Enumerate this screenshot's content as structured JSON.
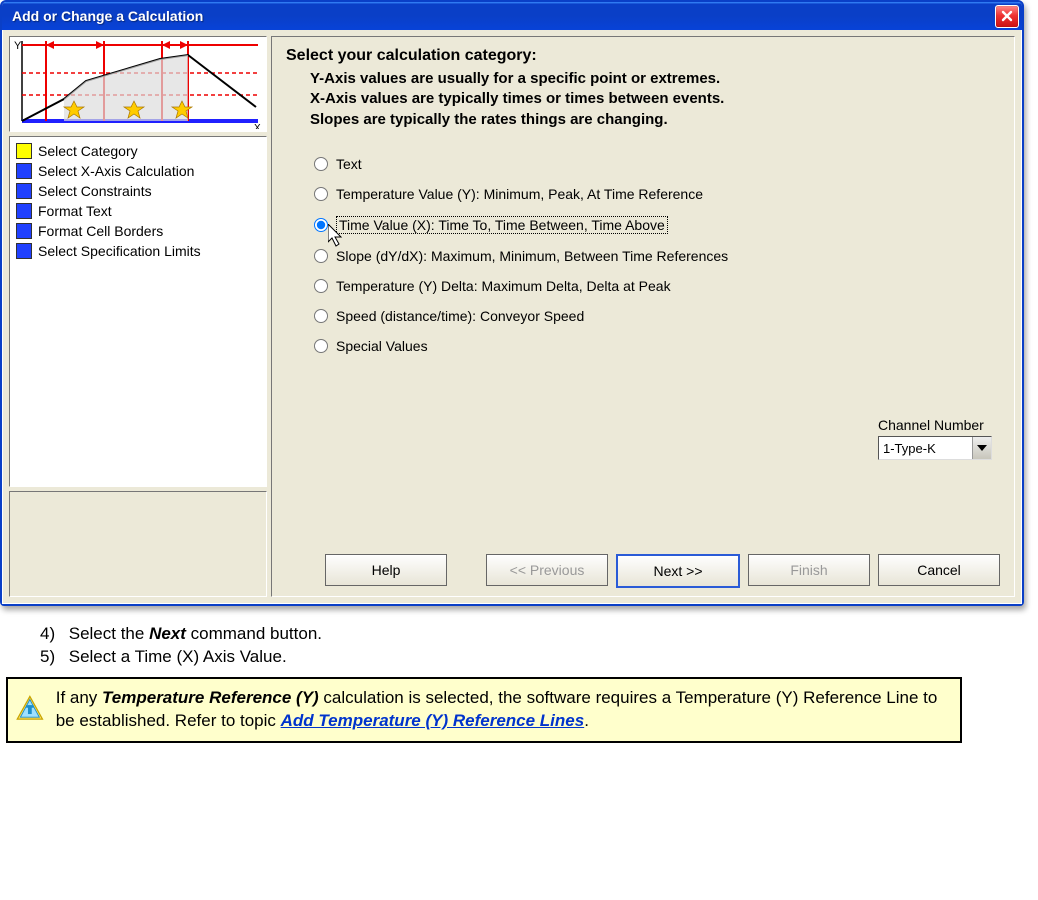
{
  "window": {
    "title": "Add or Change a Calculation"
  },
  "sidebar": {
    "steps": [
      {
        "label": "Select Category",
        "color": "#ffff00"
      },
      {
        "label": "Select X-Axis Calculation",
        "color": "#2040ff"
      },
      {
        "label": "Select Constraints",
        "color": "#2040ff"
      },
      {
        "label": "Format Text",
        "color": "#2040ff"
      },
      {
        "label": "Format Cell Borders",
        "color": "#2040ff"
      },
      {
        "label": "Select Specification Limits",
        "color": "#2040ff"
      }
    ]
  },
  "main": {
    "heading": "Select your calculation category:",
    "sub1": "Y-Axis values are usually for a specific point or extremes.",
    "sub2": "X-Axis values are typically times or times between events.",
    "sub3": "Slopes are typically the rates things are changing.",
    "options": [
      {
        "label": "Text",
        "selected": false
      },
      {
        "label": "Temperature Value (Y):  Minimum, Peak, At Time Reference",
        "selected": false
      },
      {
        "label": "Time Value (X):  Time To, Time Between, Time Above",
        "selected": true
      },
      {
        "label": "Slope (dY/dX):  Maximum, Minimum, Between Time References",
        "selected": false
      },
      {
        "label": "Temperature (Y) Delta:  Maximum Delta, Delta at Peak",
        "selected": false
      },
      {
        "label": "Speed (distance/time): Conveyor Speed",
        "selected": false
      },
      {
        "label": "Special  Values",
        "selected": false
      }
    ],
    "channel_label": "Channel Number",
    "channel_value": "1-Type-K"
  },
  "buttons": {
    "help": "Help",
    "prev": "<< Previous",
    "next": "Next >>",
    "finish": "Finish",
    "cancel": "Cancel"
  },
  "instructions": {
    "step4_num": "4)",
    "step4_a": "Select the ",
    "step4_b": "Next",
    "step4_c": " command button.",
    "step5_num": "5)",
    "step5": "Select a Time (X) Axis Value."
  },
  "note": {
    "a": "If any ",
    "b": "Temperature Reference (Y)",
    "c": " calculation is selected, the software requires a Temperature (Y) Reference Line to be established. Refer to topic ",
    "link": "Add Temperature (Y) Reference Lines",
    "d": "."
  }
}
